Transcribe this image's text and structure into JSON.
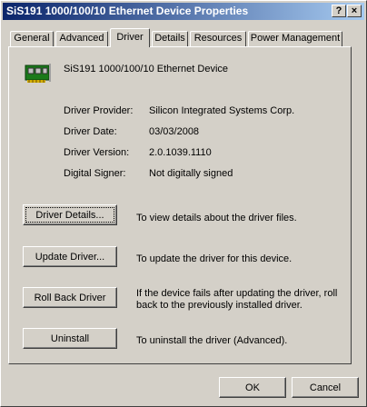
{
  "window": {
    "title": "SiS191 1000/100/10 Ethernet Device Properties"
  },
  "titlebar": {
    "help_label": "?",
    "close_label": "×"
  },
  "tabs": [
    {
      "label": "General"
    },
    {
      "label": "Advanced"
    },
    {
      "label": "Driver",
      "active": true
    },
    {
      "label": "Details"
    },
    {
      "label": "Resources"
    },
    {
      "label": "Power Management"
    }
  ],
  "device": {
    "name": "SiS191 1000/100/10 Ethernet Device",
    "icon": "network-adapter-icon"
  },
  "driver_info": {
    "provider_label": "Driver Provider:",
    "provider_value": "Silicon Integrated Systems Corp.",
    "date_label": "Driver Date:",
    "date_value": "03/03/2008",
    "version_label": "Driver Version:",
    "version_value": "2.0.1039.1110",
    "signer_label": "Digital Signer:",
    "signer_value": "Not digitally signed"
  },
  "actions": {
    "details_label": "Driver Details...",
    "details_desc": "To view details about the driver files.",
    "update_label": "Update Driver...",
    "update_desc": "To update the driver for this device.",
    "rollback_label": "Roll Back Driver",
    "rollback_desc": "If the device fails after updating the driver, roll back to the previously installed driver.",
    "uninstall_label": "Uninstall",
    "uninstall_desc": "To uninstall the driver (Advanced)."
  },
  "footer": {
    "ok_label": "OK",
    "cancel_label": "Cancel"
  },
  "colors": {
    "titlebar_start": "#0a246a",
    "titlebar_end": "#a6caf0",
    "face": "#d4d0c8"
  }
}
